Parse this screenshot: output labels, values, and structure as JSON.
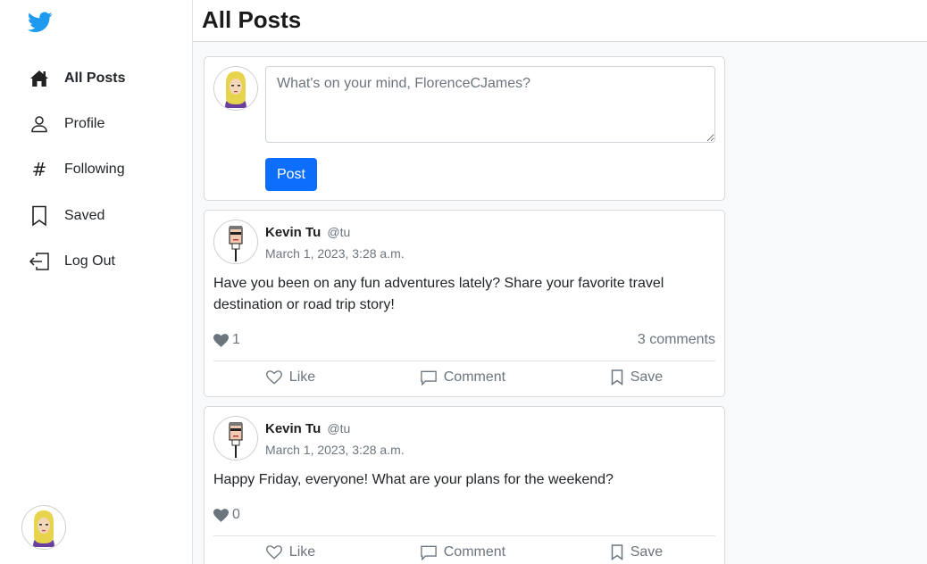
{
  "sidebar": {
    "logo": "twitter-bird-icon",
    "items": [
      {
        "label": "All Posts",
        "icon": "home-icon",
        "active": true
      },
      {
        "label": "Profile",
        "icon": "person-icon",
        "active": false
      },
      {
        "label": "Following",
        "icon": "hash-icon",
        "active": false
      },
      {
        "label": "Saved",
        "icon": "bookmark-icon",
        "active": false
      },
      {
        "label": "Log Out",
        "icon": "logout-icon",
        "active": false
      }
    ],
    "hash_glyph": "#"
  },
  "header": {
    "title": "All Posts"
  },
  "composer": {
    "placeholder": "What's on your mind, FlorenceCJames?",
    "button_label": "Post"
  },
  "posts": [
    {
      "author": "Kevin Tu",
      "handle": "@tu",
      "timestamp": "March 1, 2023, 3:28 a.m.",
      "body": "Have you been on any fun adventures lately? Share your favorite travel destination or road trip story!",
      "likes": "1",
      "comments": "3 comments",
      "actions": {
        "like": "Like",
        "comment": "Comment",
        "save": "Save"
      }
    },
    {
      "author": "Kevin Tu",
      "handle": "@tu",
      "timestamp": "March 1, 2023, 3:28 a.m.",
      "body": "Happy Friday, everyone! What are your plans for the weekend?",
      "likes": "0",
      "comments": "",
      "actions": {
        "like": "Like",
        "comment": "Comment",
        "save": "Save"
      }
    }
  ],
  "colors": {
    "brand": "#1d9bf0",
    "primary_button": "#0d6efd",
    "muted_text": "#6c757d",
    "content_bg": "#f8f9fa"
  }
}
